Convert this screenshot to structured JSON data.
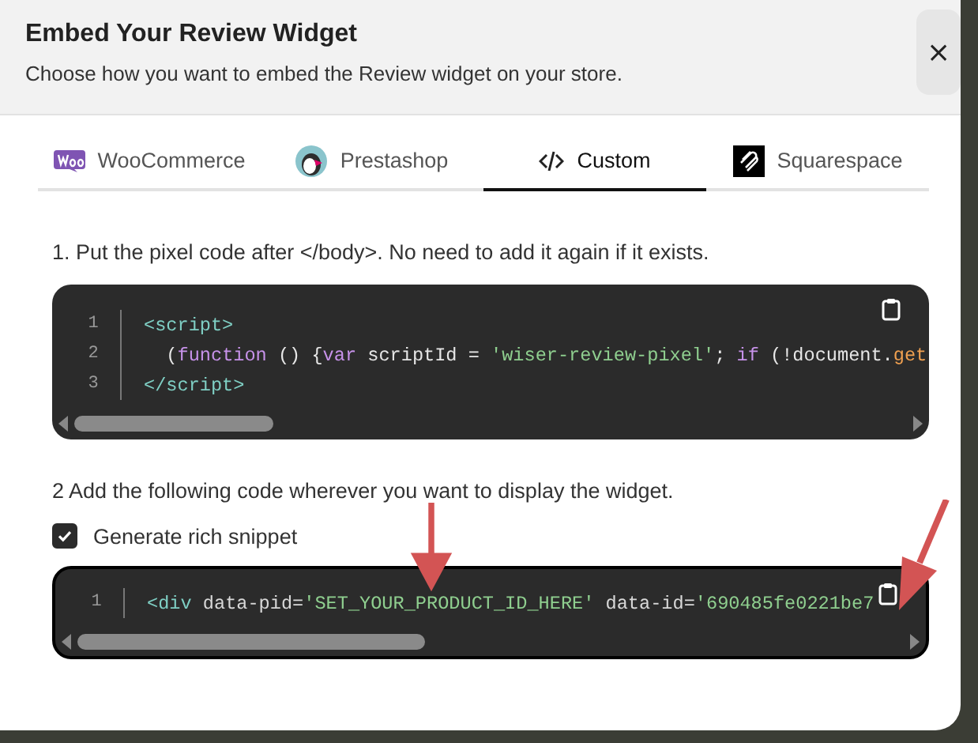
{
  "dialog": {
    "title": "Embed Your Review Widget",
    "subtitle": "Choose how you want to embed the Review widget on your store.",
    "close": "×"
  },
  "tabs": [
    {
      "label": "WooCommerce",
      "selected": false
    },
    {
      "label": "Prestashop",
      "selected": false
    },
    {
      "label": "Custom",
      "selected": true
    },
    {
      "label": "Squarespace",
      "selected": false
    }
  ],
  "steps": [
    {
      "instruction": "1. Put the pixel code after </body>. No need to add it again if it exists.",
      "code": [
        {
          "number": "1",
          "tokens": [
            {
              "kind": "tag",
              "text": "<script>"
            }
          ]
        },
        {
          "number": "2",
          "tokens": [
            {
              "kind": "plain",
              "text": "  ("
            },
            {
              "kind": "keyword",
              "text": "function"
            },
            {
              "kind": "plain",
              "text": " () {"
            },
            {
              "kind": "keyword",
              "text": "var"
            },
            {
              "kind": "plain",
              "text": " scriptId = "
            },
            {
              "kind": "string",
              "text": "'wiser-review-pixel'"
            },
            {
              "kind": "plain",
              "text": "; "
            },
            {
              "kind": "keyword",
              "text": "if"
            },
            {
              "kind": "plain",
              "text": " (!document."
            },
            {
              "kind": "method",
              "text": "get"
            }
          ]
        },
        {
          "number": "3",
          "tokens": [
            {
              "kind": "tag",
              "text": "</script>"
            }
          ]
        }
      ]
    },
    {
      "instruction": "2 Add the following code wherever you want to display the widget.",
      "option": {
        "label": "Generate rich snippet",
        "checked": true
      },
      "code": [
        {
          "number": "1",
          "tokens": [
            {
              "kind": "tag",
              "text": "<div"
            },
            {
              "kind": "attr",
              "text": " data-pid="
            },
            {
              "kind": "string",
              "text": "'SET_YOUR_PRODUCT_ID_HERE'"
            },
            {
              "kind": "attr",
              "text": " data-id="
            },
            {
              "kind": "string",
              "text": "'690485fe0221be7"
            }
          ]
        }
      ]
    }
  ]
}
